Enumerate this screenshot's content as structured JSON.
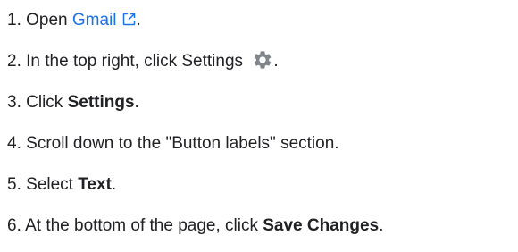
{
  "steps": [
    {
      "number": "1.",
      "prefix": "Open ",
      "link": "Gmail",
      "suffix": "."
    },
    {
      "number": "2.",
      "text": "In the top right, click Settings ",
      "suffix": "."
    },
    {
      "number": "3.",
      "prefix": "Click ",
      "bold": "Settings",
      "suffix": "."
    },
    {
      "number": "4.",
      "text": "Scroll down to the \"Button labels\" section."
    },
    {
      "number": "5.",
      "prefix": "Select ",
      "bold": "Text",
      "suffix": "."
    },
    {
      "number": "6.",
      "prefix": "At the bottom of the page, click ",
      "bold": "Save Changes",
      "suffix": "."
    }
  ],
  "icons": {
    "external_link": "open-in-new-icon",
    "settings": "gear-icon"
  },
  "colors": {
    "text": "#202124",
    "link": "#1a73e8",
    "icon_gray": "#80868b"
  }
}
